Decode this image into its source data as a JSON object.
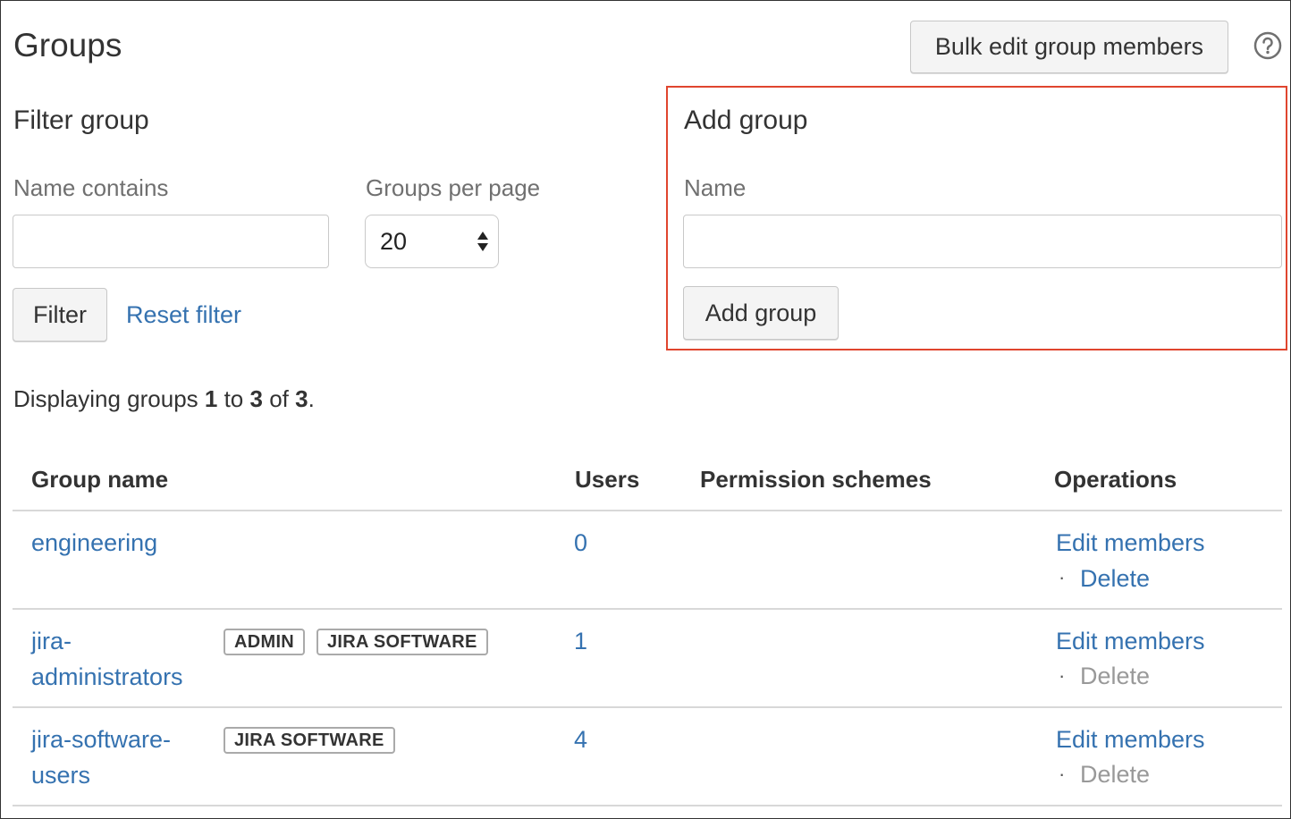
{
  "header": {
    "title": "Groups",
    "bulk_edit_label": "Bulk edit group members"
  },
  "filter": {
    "title": "Filter group",
    "name_contains_label": "Name contains",
    "name_contains_value": "",
    "per_page_label": "Groups per page",
    "per_page_value": "20",
    "filter_button": "Filter",
    "reset_link": "Reset filter"
  },
  "add_group": {
    "title": "Add group",
    "name_label": "Name",
    "name_value": "",
    "button": "Add group"
  },
  "display": {
    "prefix": "Displaying groups ",
    "from": "1",
    "to_word": " to ",
    "to": "3",
    "of_word": " of ",
    "total": "3",
    "suffix": "."
  },
  "table": {
    "headers": {
      "group_name": "Group name",
      "users": "Users",
      "permission_schemes": "Permission schemes",
      "operations": "Operations"
    },
    "rows": [
      {
        "name_line1": "engineering",
        "name_line2": "",
        "users": "0",
        "edit": "Edit members",
        "delete": "Delete",
        "delete_enabled": true
      },
      {
        "name_line1": "jira-",
        "name_line2": "administrators",
        "badges": [
          "ADMIN",
          "JIRA SOFTWARE"
        ],
        "users": "1",
        "edit": "Edit members",
        "delete": "Delete",
        "delete_enabled": false
      },
      {
        "name_line1": "jira-software-",
        "name_line2": "users",
        "badges": [
          "JIRA SOFTWARE"
        ],
        "users": "4",
        "edit": "Edit members",
        "delete": "Delete",
        "delete_enabled": false
      }
    ],
    "separator": "·"
  },
  "colors": {
    "link": "#3572b0",
    "highlight_border": "#e0452e",
    "disabled": "#999999"
  },
  "icons": {
    "help": "question-circle-icon",
    "select_arrows": "up-down-arrows-icon"
  }
}
